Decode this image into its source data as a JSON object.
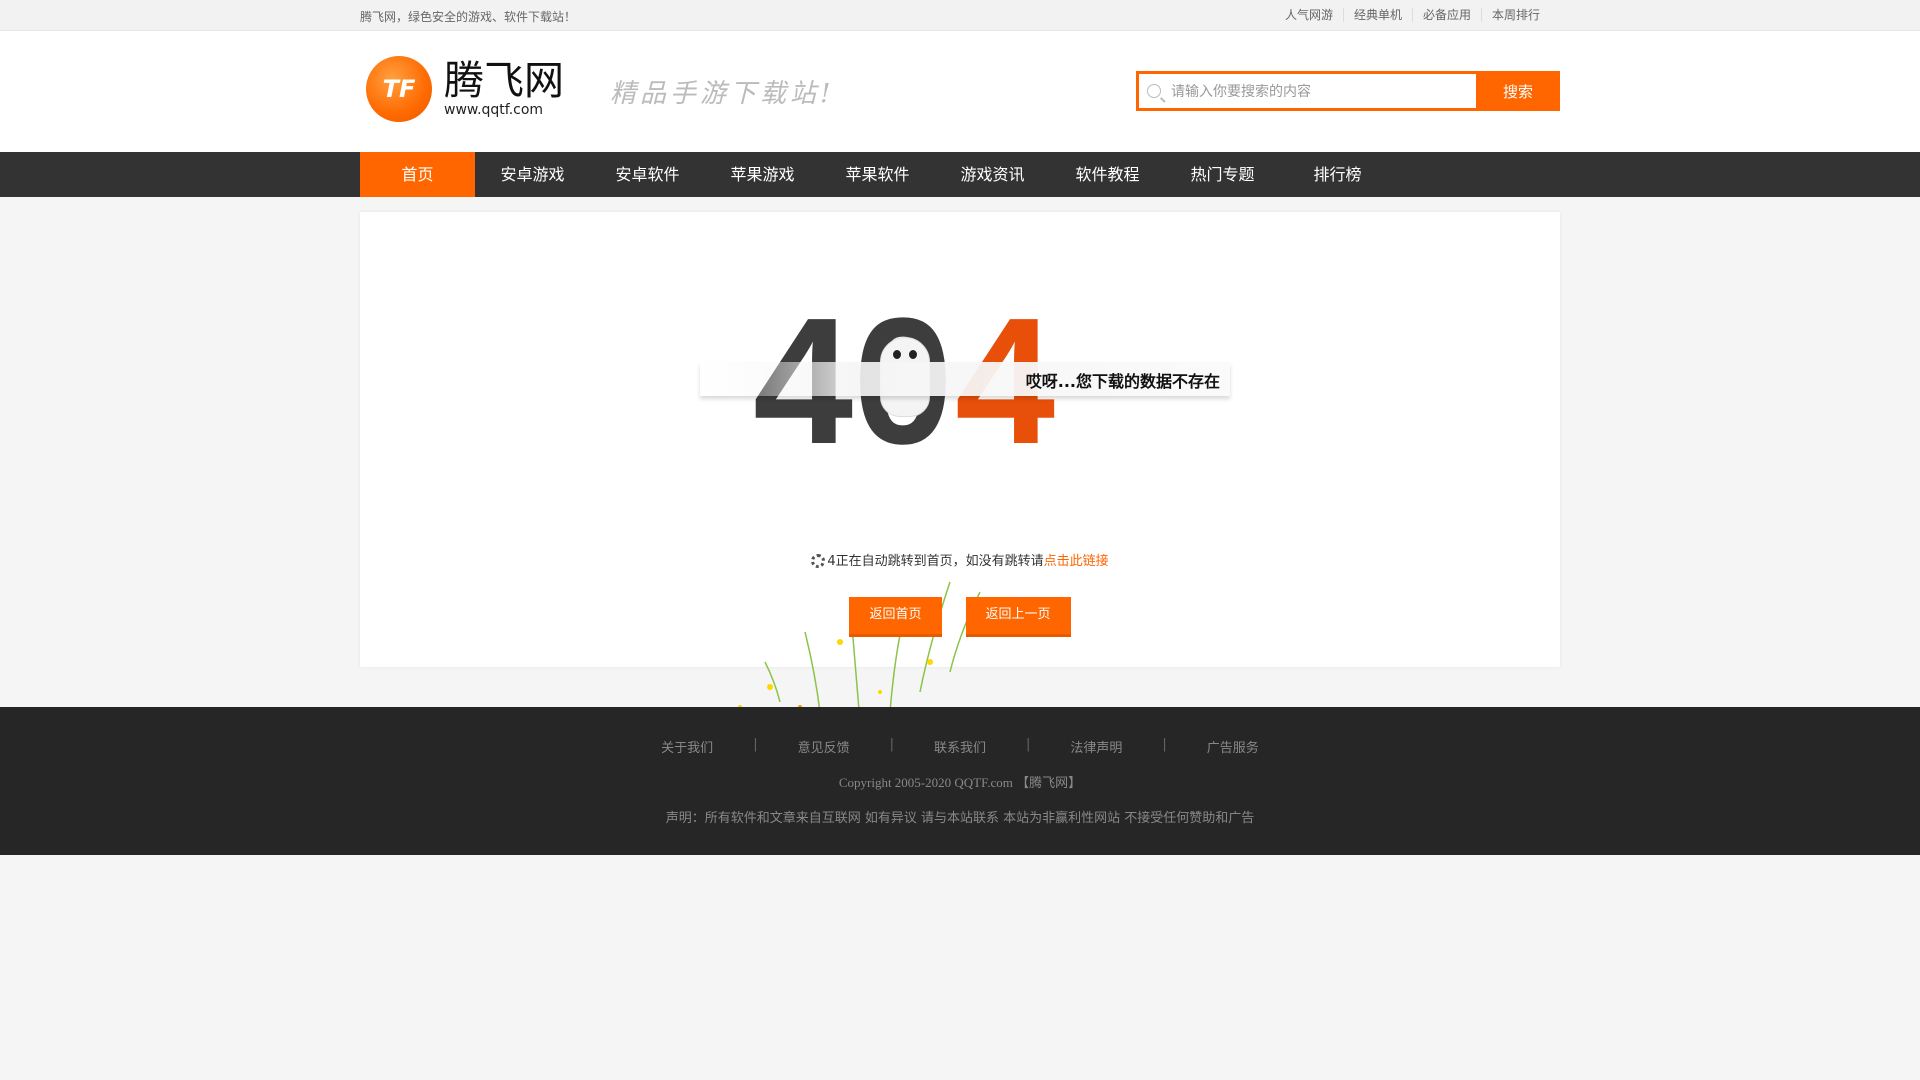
{
  "topbar": {
    "slogan": "腾飞网，绿色安全的游戏、软件下载站！",
    "links": [
      "人气网游",
      "经典单机",
      "必备应用",
      "本周排行"
    ]
  },
  "header": {
    "logo_mark": "TF",
    "logo_name": "腾飞网",
    "logo_url": "www.qqtf.com",
    "tagline": "精品手游下载站!",
    "search_placeholder": "请输入你要搜索的内容",
    "search_button": "搜索"
  },
  "nav": [
    "首页",
    "安卓游戏",
    "安卓软件",
    "苹果游戏",
    "苹果软件",
    "游戏资讯",
    "软件教程",
    "热门专题",
    "排行榜"
  ],
  "error": {
    "d1": "4",
    "d2": "0",
    "d3": "4",
    "message": "哎呀...您下载的数据不存在",
    "countdown": "4",
    "redirect_text": "正在自动跳转到首页，如没有跳转请",
    "redirect_link": "点击此链接",
    "btn_home": "返回首页",
    "btn_back": "返回上一页"
  },
  "footer": {
    "links": [
      "关于我们",
      "意见反馈",
      "联系我们",
      "法律声明",
      "广告服务"
    ],
    "separator": "|",
    "copyright": "Copyright 2005-2020 QQTF.com 【腾飞网】",
    "statement": "声明：所有软件和文章来自互联网 如有异议 请与本站联系 本站为非赢利性网站 不接受任何赞助和广告"
  },
  "colors": {
    "accent": "#ff6600",
    "nav_bg": "#333333",
    "footer_bg": "#262626"
  }
}
